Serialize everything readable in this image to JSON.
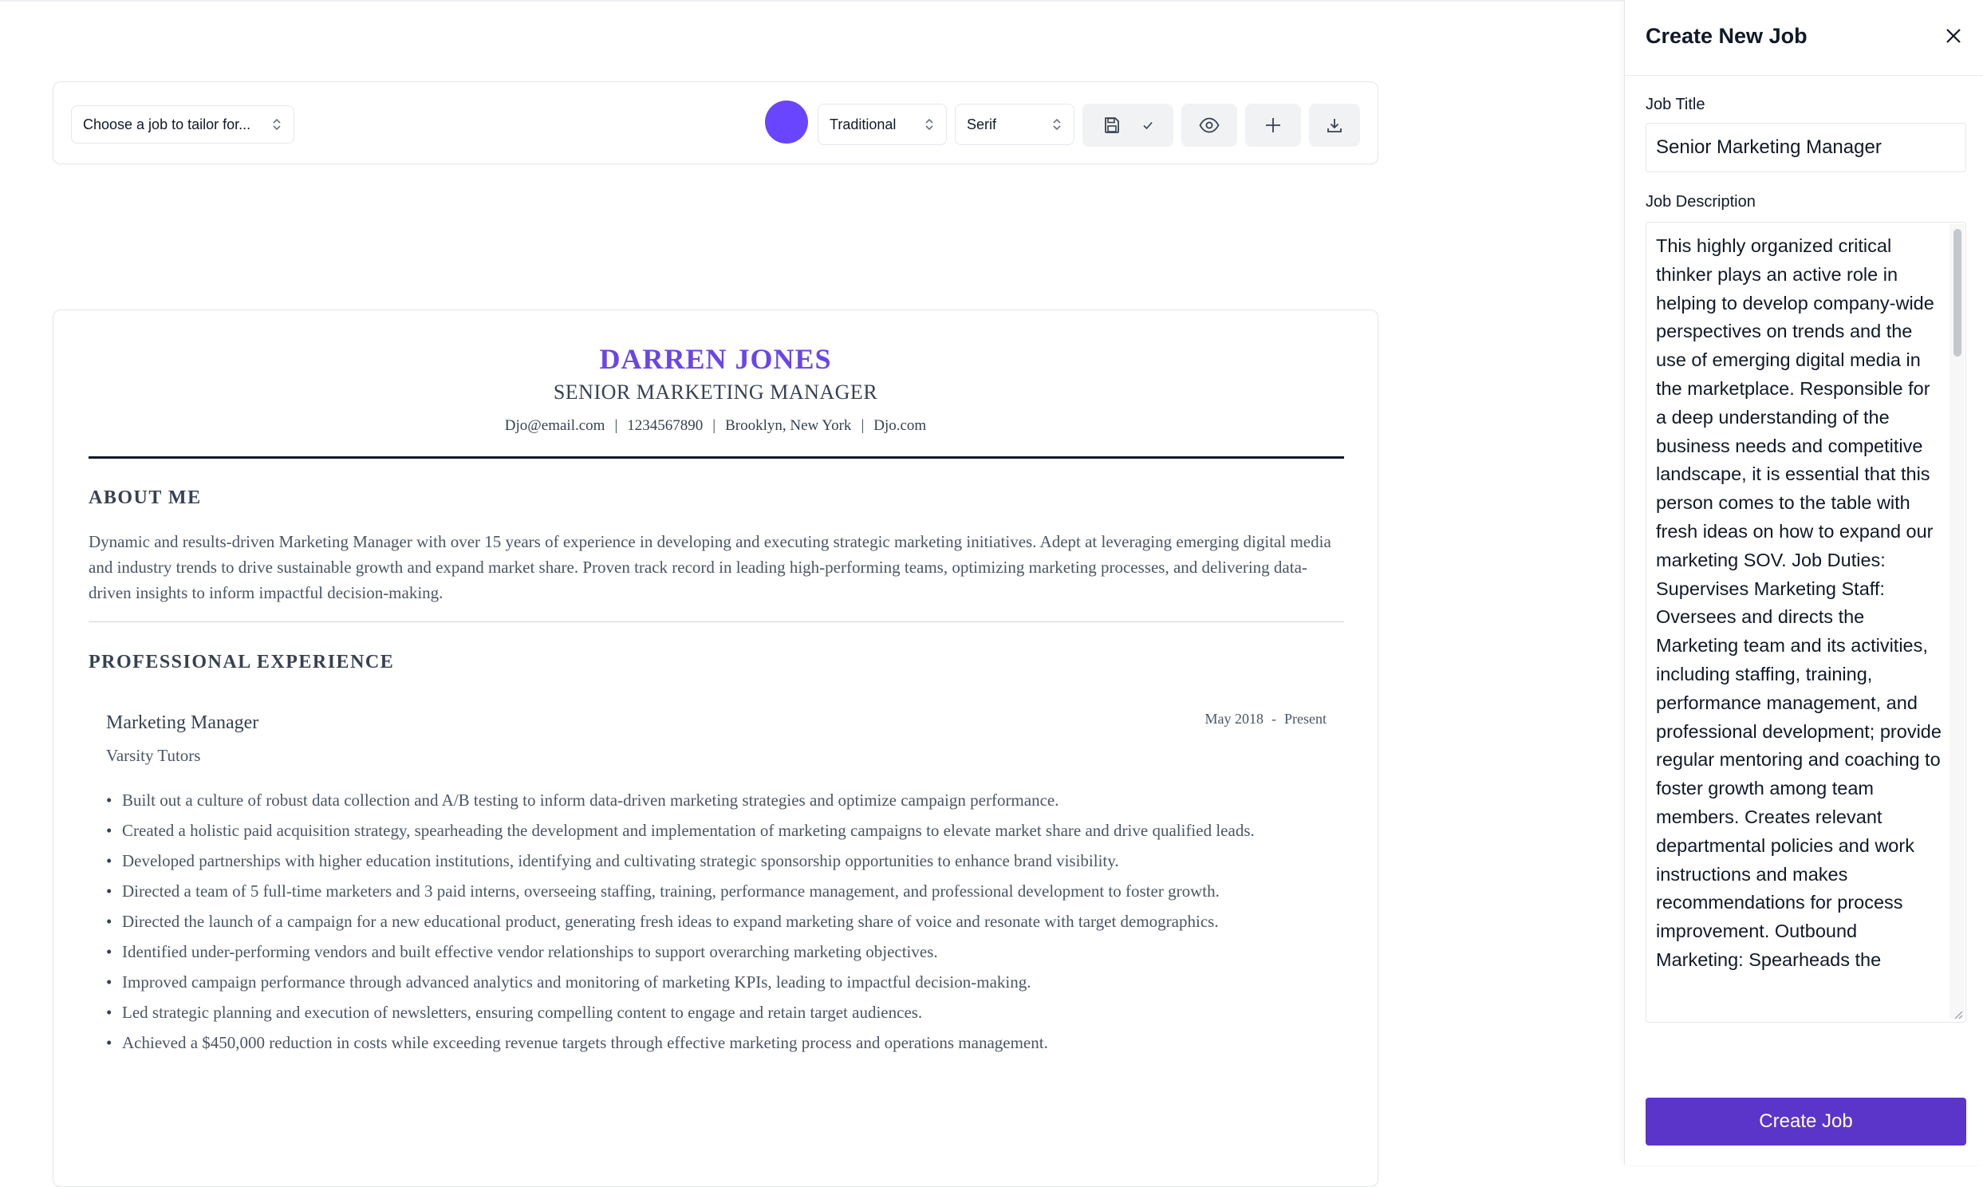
{
  "colors": {
    "accent": "#6d4aff",
    "name_color": "#6a45e8",
    "primary_button": "#5b35c9",
    "color_swatch": "#6a45ff"
  },
  "toolbar": {
    "job_select_value": "Choose a job to tailor for...",
    "template_value": "Traditional",
    "font_value": "Serif",
    "icons": [
      "save-icon",
      "check-icon",
      "eye-icon",
      "plus-icon",
      "download-icon"
    ]
  },
  "resume": {
    "name": "DARREN JONES",
    "role": "SENIOR MARKETING MANAGER",
    "contact": {
      "email": "Djo@email.com",
      "phone": "1234567890",
      "location": "Brooklyn, New York",
      "website": "Djo.com",
      "separator": "|"
    },
    "about": {
      "heading": "ABOUT ME",
      "text": "Dynamic and results-driven Marketing Manager with over 15 years of experience in developing and executing strategic marketing initiatives. Adept at leveraging emerging digital media and industry trends to drive sustainable growth and expand market share. Proven track record in leading high-performing teams, optimizing marketing processes, and delivering data-driven insights to inform impactful decision-making."
    },
    "experience": {
      "heading": "PROFESSIONAL EXPERIENCE",
      "jobs": [
        {
          "title": "Marketing Manager",
          "company": "Varsity Tutors",
          "start": "May 2018",
          "date_sep": "-",
          "end": "Present",
          "bullets": [
            "Built out a culture of robust data collection and A/B testing to inform data-driven marketing strategies and optimize campaign performance.",
            "Created a holistic paid acquisition strategy, spearheading the development and implementation of marketing campaigns to elevate market share and drive qualified leads.",
            "Developed partnerships with higher education institutions, identifying and cultivating strategic sponsorship opportunities to enhance brand visibility.",
            "Directed a team of 5 full-time marketers and 3 paid interns, overseeing staffing, training, performance management, and professional development to foster growth.",
            "Directed the launch of a campaign for a new educational product, generating fresh ideas to expand marketing share of voice and resonate with target demographics.",
            "Identified under-performing vendors and built effective vendor relationships to support overarching marketing objectives.",
            "Improved campaign performance through advanced analytics and monitoring of marketing KPIs, leading to impactful decision-making.",
            "Led strategic planning and execution of newsletters, ensuring compelling content to engage and retain target audiences.",
            "Achieved a $450,000 reduction in costs while exceeding revenue targets through effective marketing process and operations management."
          ]
        }
      ]
    }
  },
  "panel": {
    "title": "Create New Job",
    "job_title_label": "Job Title",
    "job_title_value": "Senior Marketing Manager",
    "job_description_label": "Job Description",
    "job_description_value": "This highly organized critical thinker plays an active role in helping to develop company-wide perspectives on trends and the use of emerging digital media in the marketplace. Responsible for a deep understanding of the business needs and competitive landscape, it is essential that this person comes to the table with fresh ideas on how to expand our marketing SOV. Job Duties: Supervises Marketing Staff: Oversees and directs the Marketing team and its activities, including staffing, training, performance management, and professional development; provide regular mentoring and coaching to foster growth among team members. Creates relevant departmental policies and work instructions and makes recommendations for process improvement. Outbound Marketing: Spearheads the",
    "create_button": "Create Job"
  }
}
